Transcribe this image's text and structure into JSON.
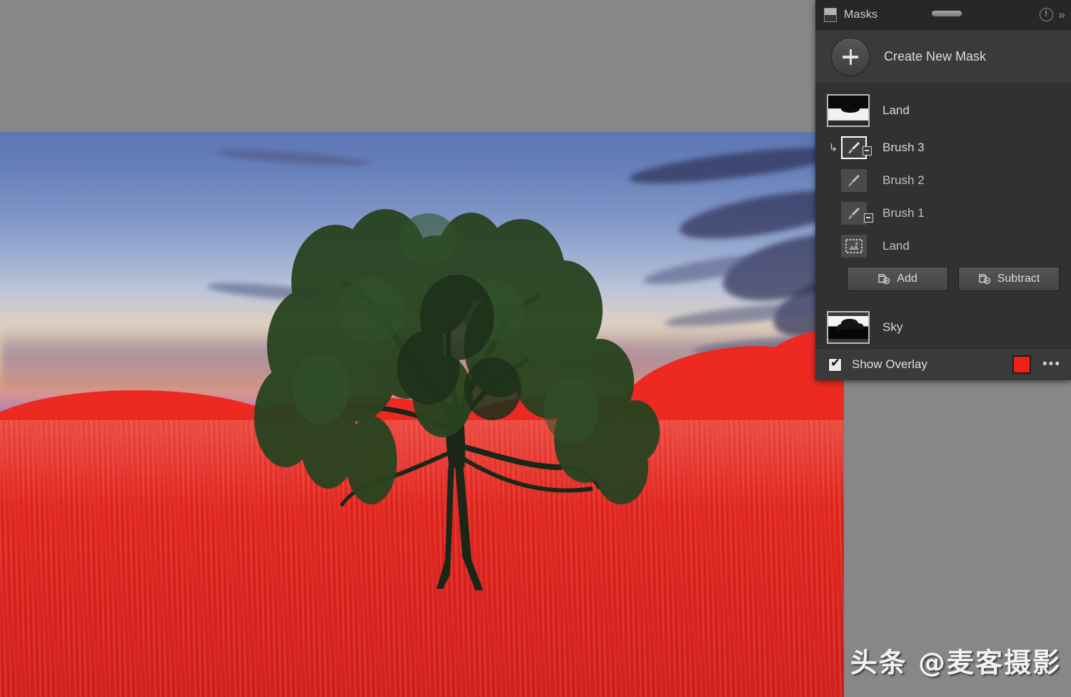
{
  "app": {
    "canvas_background": "#878787",
    "overlay_color": "#ee2019"
  },
  "panel": {
    "title": "Masks",
    "header_icon": "mask-panel-icon",
    "drag_handle": "panel-drag-handle",
    "help_icon": "help-circle-icon",
    "collapse_icon": "»",
    "create": {
      "label": "Create New Mask",
      "icon": "plus-icon"
    },
    "masks": [
      {
        "name": "Land",
        "icon": "mask-thumbnail",
        "thumbnail": "land-thumbnail",
        "selected": false,
        "children": [
          {
            "name": "Brush 3",
            "icon": "brush-icon",
            "mode": "subtract",
            "selected": true,
            "has_arrow": true
          },
          {
            "name": "Brush 2",
            "icon": "brush-icon",
            "mode": "add",
            "selected": false,
            "has_arrow": false
          },
          {
            "name": "Brush 1",
            "icon": "brush-icon",
            "mode": "subtract",
            "selected": false,
            "has_arrow": false
          },
          {
            "name": "Land",
            "icon": "select-subject-icon",
            "mode": "add",
            "selected": false,
            "has_arrow": false
          }
        ],
        "actions": [
          {
            "label": "Add",
            "icon": "mask-add-icon"
          },
          {
            "label": "Subtract",
            "icon": "mask-subtract-icon"
          }
        ]
      },
      {
        "name": "Sky",
        "icon": "mask-thumbnail",
        "thumbnail": "sky-thumbnail",
        "selected": false,
        "children": [],
        "actions": []
      }
    ],
    "footer": {
      "show_overlay_label": "Show Overlay",
      "show_overlay_checked": true,
      "check_glyph": "✔",
      "overlay_swatch_color": "#ee2019",
      "more_menu": "•••"
    }
  },
  "photo": {
    "description": "Sunset photo of a lone tree in a wheat field with red mask overlay on the land",
    "mask_overlay_color": "#ec2a22"
  },
  "watermark": {
    "text": "头条 @麦客摄影"
  }
}
